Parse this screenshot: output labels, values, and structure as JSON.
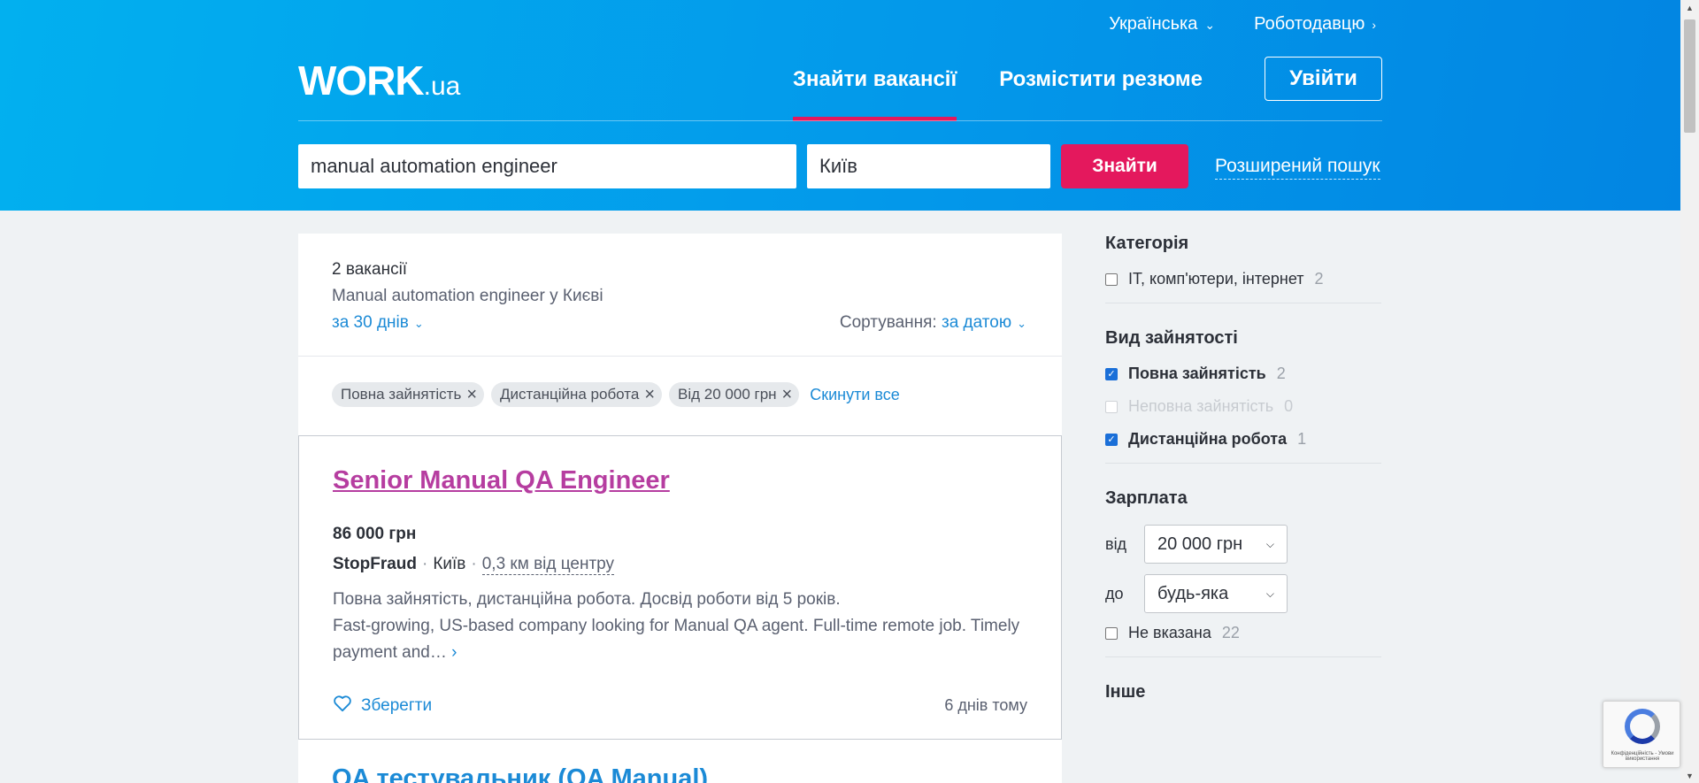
{
  "topnav": {
    "language": "Українська",
    "employer": "Роботодавцю"
  },
  "logo": {
    "main": "WORK",
    "suffix": ".ua"
  },
  "mainnav": {
    "find_jobs": "Знайти вакансії",
    "post_resume": "Розмістити резюме",
    "login": "Увійти"
  },
  "search": {
    "query": "manual automation engineer",
    "city": "Київ",
    "button": "Знайти",
    "advanced": "Розширений пошук"
  },
  "results": {
    "count": "2 вакансії",
    "query_text": "Manual automation engineer у Києві",
    "period": "за 30 днів",
    "sort_label": "Сортування:",
    "sort_value": "за датою",
    "filters": [
      "Повна зайнятість",
      "Дистанційна робота",
      "Від 20 000 грн"
    ],
    "reset": "Скинути все"
  },
  "job": {
    "title": "Senior Manual QA Engineer",
    "salary": "86 000 грн",
    "company": "StopFraud",
    "city": "Київ",
    "distance": "0,3 км від центру",
    "desc_line1": "Повна зайнятість, дистанційна робота. Досвід роботи від 5 років.",
    "desc_line2": "Fast-growing, US-based company looking for Manual QA agent. Full-time remote job. Timely payment and…",
    "save": "Зберегти",
    "posted": "6 днів тому"
  },
  "next_job": {
    "title": "QA тестувальник (QA Manual)"
  },
  "sidebar": {
    "category": {
      "title": "Категорія",
      "items": [
        {
          "label": "IT, комп'ютери, інтернет",
          "count": "2"
        }
      ]
    },
    "employment": {
      "title": "Вид зайнятості",
      "items": [
        {
          "label": "Повна зайнятість",
          "count": "2",
          "checked": true
        },
        {
          "label": "Неповна зайнятість",
          "count": "0",
          "disabled": true
        },
        {
          "label": "Дистанційна робота",
          "count": "1",
          "checked": true
        }
      ]
    },
    "salary": {
      "title": "Зарплата",
      "from_label": "від",
      "from_value": "20 000 грн",
      "to_label": "до",
      "to_value": "будь-яка",
      "not_specified": "Не вказана",
      "not_specified_count": "22"
    },
    "other": {
      "title": "Інше"
    }
  },
  "recaptcha": {
    "text": "Конфіденційність - Умови використання"
  }
}
